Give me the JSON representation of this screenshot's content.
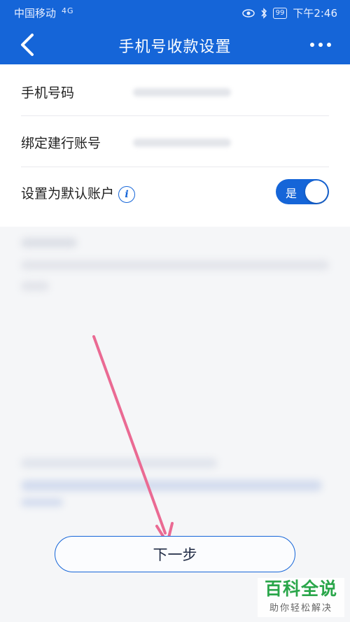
{
  "status_bar": {
    "carrier": "中国移动",
    "network": "4G",
    "battery": "99",
    "time": "下午2:46"
  },
  "nav": {
    "title": "手机号收款设置",
    "back_icon": "chevron-left-icon",
    "more_icon": "more-dots-icon"
  },
  "form": {
    "rows": [
      {
        "label": "手机号码"
      },
      {
        "label": "绑定建行账号"
      },
      {
        "label": "设置为默认账户",
        "toggle_text": "是",
        "toggle_on": true
      }
    ]
  },
  "next_button": "下一步",
  "watermark": {
    "title": "百科全说",
    "subtitle": "助你轻松解决"
  },
  "colors": {
    "primary": "#1565d8",
    "annotation_arrow": "#ea6a93",
    "watermark_green": "#2aa64a"
  }
}
